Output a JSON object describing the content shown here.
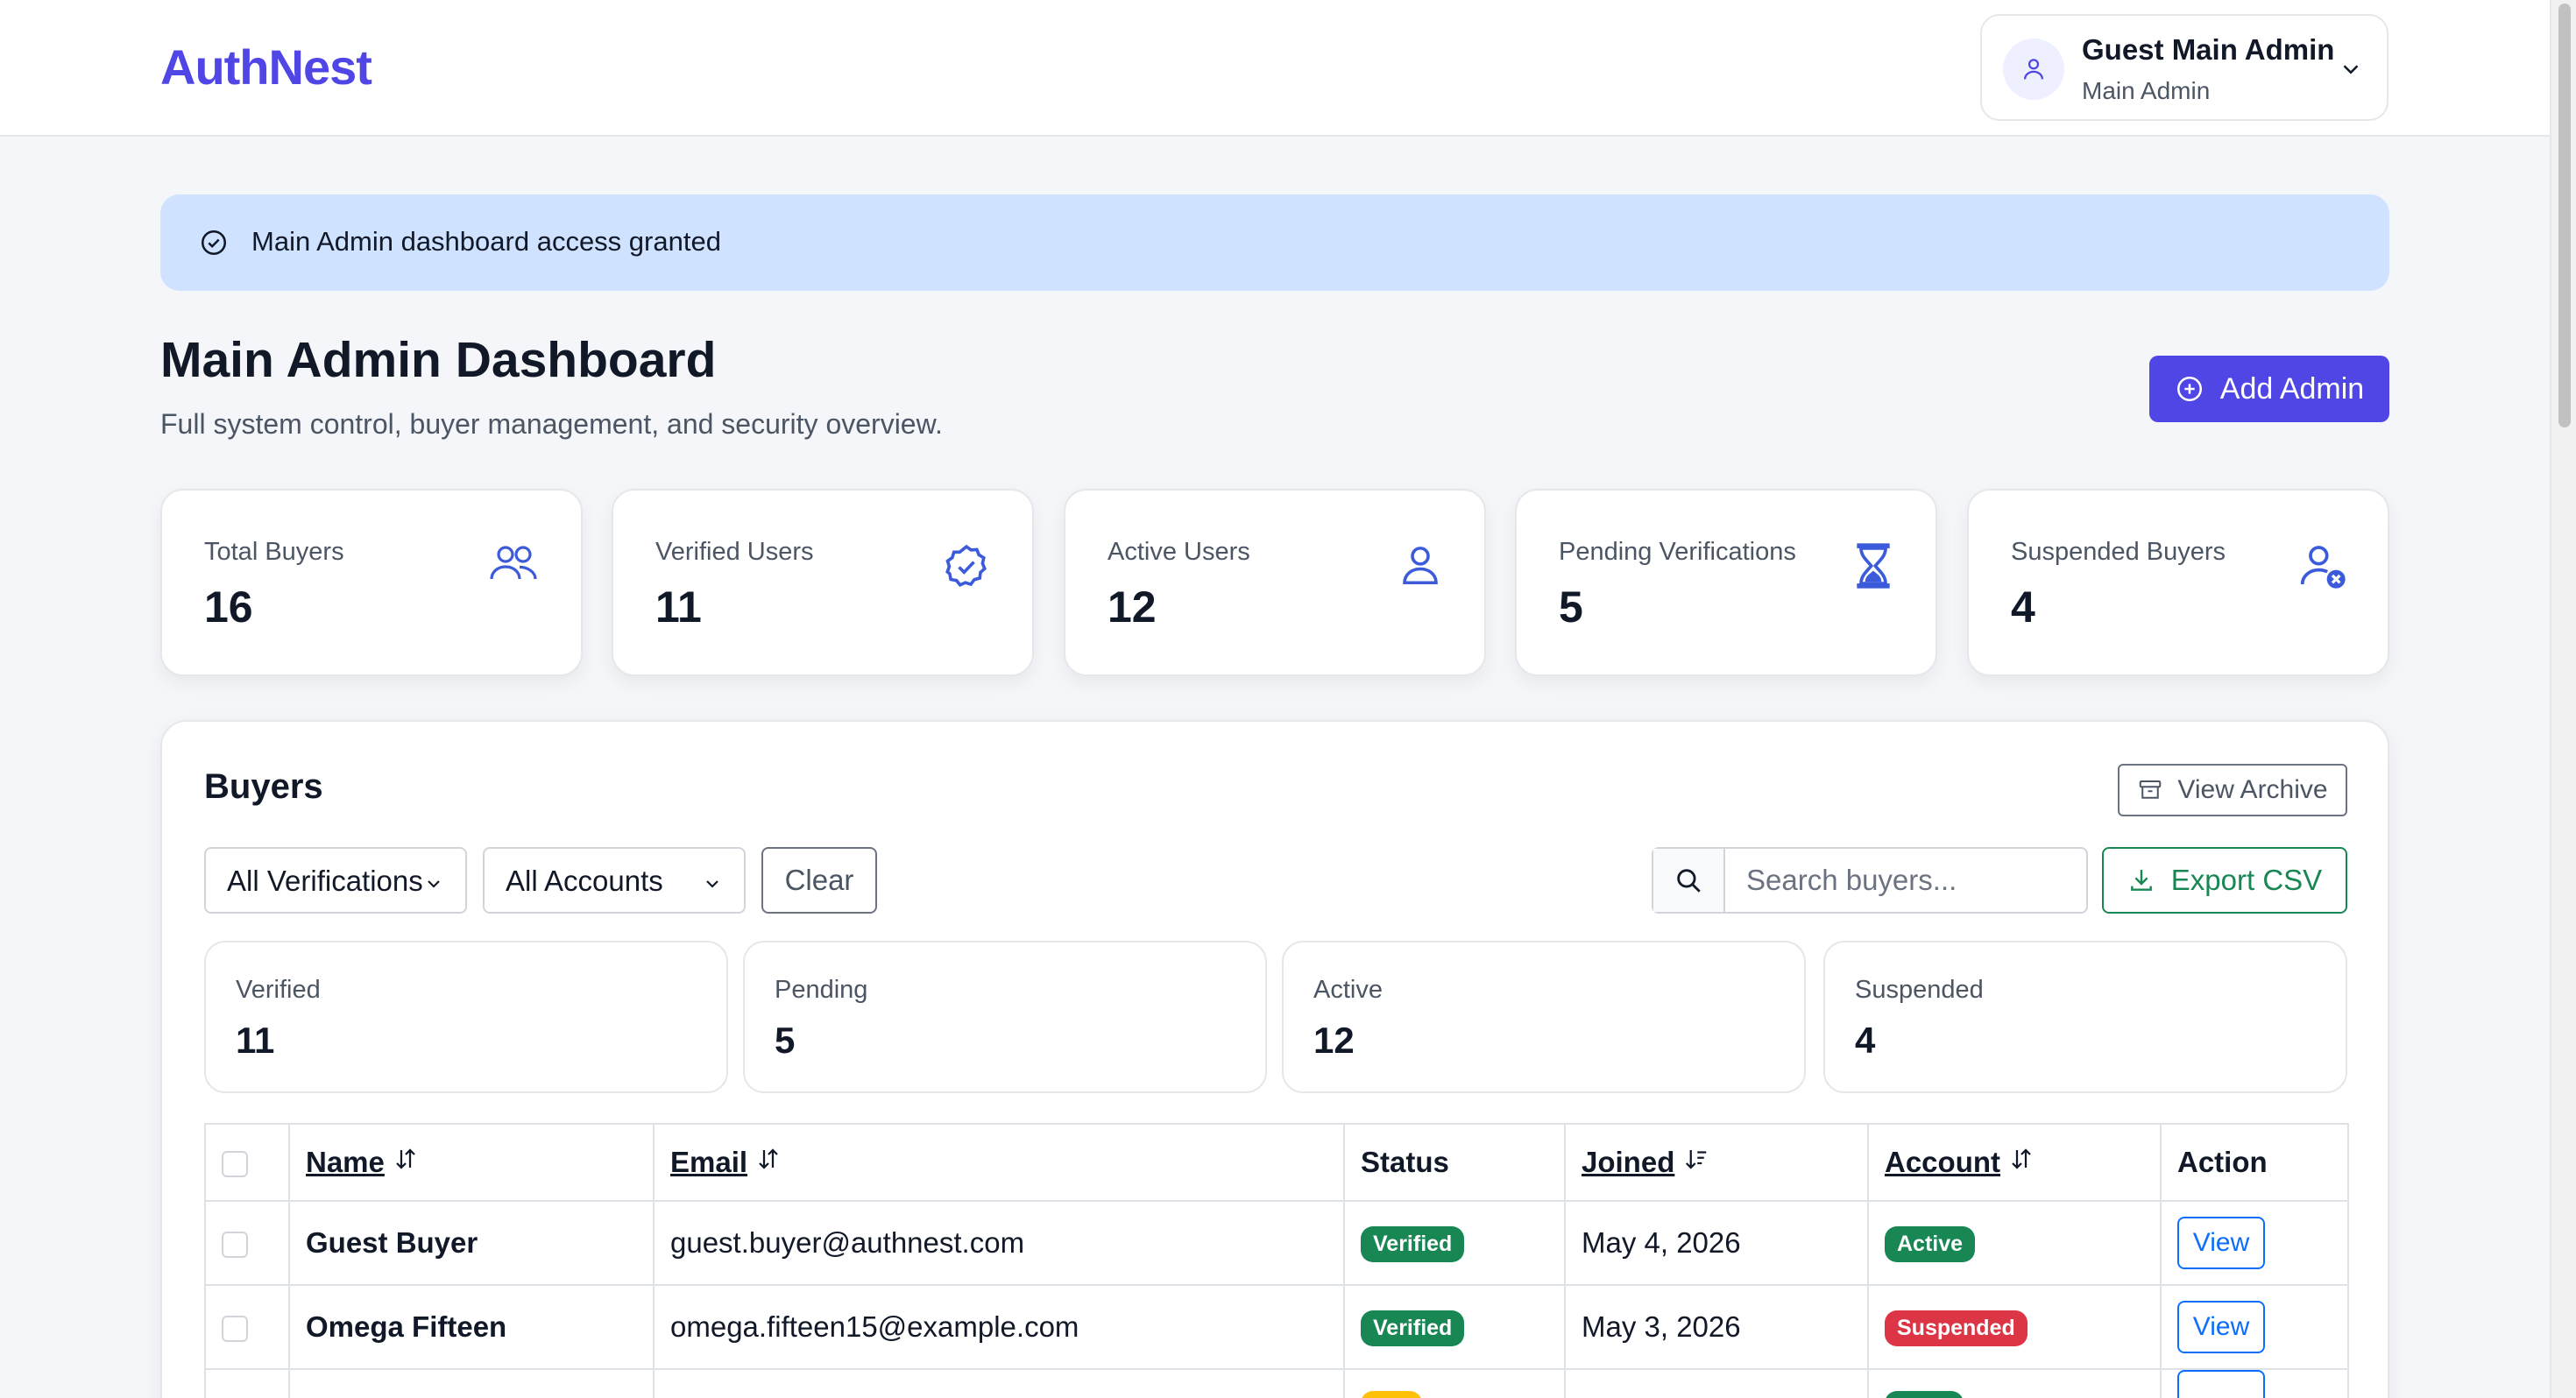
{
  "app": {
    "brand": "AuthNest"
  },
  "user": {
    "name": "Guest Main Admin",
    "role": "Main Admin",
    "avatar_icon": "user-icon"
  },
  "alert": {
    "text": "Main Admin dashboard access granted",
    "icon": "check-circle-icon"
  },
  "page": {
    "title": "Main Admin Dashboard",
    "subtitle": "Full system control, buyer management, and security overview.",
    "add_admin_label": "Add Admin"
  },
  "stats": [
    {
      "label": "Total Buyers",
      "value": "16",
      "icon": "users-icon"
    },
    {
      "label": "Verified Users",
      "value": "11",
      "icon": "verified-badge-icon"
    },
    {
      "label": "Active Users",
      "value": "12",
      "icon": "user-icon"
    },
    {
      "label": "Pending Verifications",
      "value": "5",
      "icon": "hourglass-icon"
    },
    {
      "label": "Suspended Buyers",
      "value": "4",
      "icon": "user-x-icon"
    }
  ],
  "buyers": {
    "title": "Buyers",
    "archive_label": "View Archive",
    "filters": {
      "verification": "All Verifications",
      "accounts": "All Accounts",
      "clear_label": "Clear",
      "search_placeholder": "Search buyers...",
      "export_label": "Export CSV"
    },
    "summary": [
      {
        "label": "Verified",
        "value": "11"
      },
      {
        "label": "Pending",
        "value": "5"
      },
      {
        "label": "Active",
        "value": "12"
      },
      {
        "label": "Suspended",
        "value": "4"
      }
    ],
    "columns": {
      "name": "Name",
      "email": "Email",
      "status": "Status",
      "joined": "Joined",
      "account": "Account",
      "action": "Action"
    },
    "rows": [
      {
        "name": "Guest Buyer",
        "email": "guest.buyer@authnest.com",
        "status": "Verified",
        "joined": "May 4, 2026",
        "account": "Active",
        "action": "View"
      },
      {
        "name": "Omega Fifteen",
        "email": "omega.fifteen15@example.com",
        "status": "Verified",
        "joined": "May 3, 2026",
        "account": "Suspended",
        "action": "View"
      }
    ]
  },
  "colors": {
    "brand": "#4f46e5",
    "alert_bg": "#cfe2ff",
    "success": "#198754",
    "danger": "#dc3545",
    "link": "#0d6efd",
    "warning": "#ffc107"
  }
}
